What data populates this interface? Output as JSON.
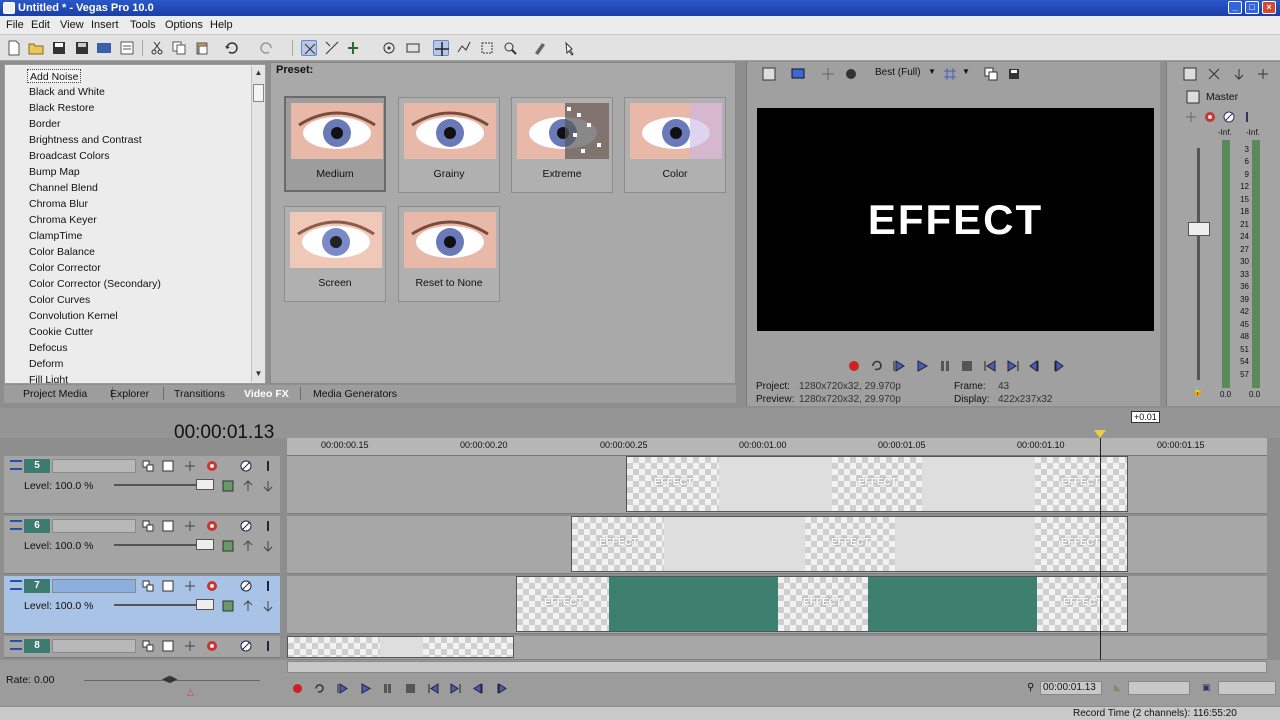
{
  "window": {
    "title": "Untitled * - Vegas Pro 10.0"
  },
  "menu": [
    "File",
    "Edit",
    "View",
    "Insert",
    "Tools",
    "Options",
    "Help"
  ],
  "fx_list": {
    "items": [
      "Add Noise",
      "Black and White",
      "Black Restore",
      "Border",
      "Brightness and Contrast",
      "Broadcast Colors",
      "Bump Map",
      "Channel Blend",
      "Chroma Blur",
      "Chroma Keyer",
      "ClampTime",
      "Color Balance",
      "Color Corrector",
      "Color Corrector (Secondary)",
      "Color Curves",
      "Convolution Kernel",
      "Cookie Cutter",
      "Defocus",
      "Deform",
      "Fill Light"
    ],
    "selected": "Add Noise"
  },
  "preset": {
    "label": "Preset:",
    "items": [
      "Medium",
      "Grainy",
      "Extreme",
      "Color",
      "Screen",
      "Reset to None"
    ],
    "selected": "Medium"
  },
  "window_tabs": [
    "Project Media",
    "Explorer",
    "Transitions",
    "Video FX",
    "Media Generators"
  ],
  "active_tab": "Video FX",
  "preview": {
    "quality": "Best (Full)",
    "screen_text": "EFFECT",
    "project_label": "Project:",
    "project_value": "1280x720x32, 29.970p",
    "preview_label": "Preview:",
    "preview_value": "1280x720x32, 29.970p",
    "frame_label": "Frame:",
    "frame_value": "43",
    "display_label": "Display:",
    "display_value": "422x237x32"
  },
  "master": {
    "label": "Master",
    "inf_left": "-Inf.",
    "inf_right": "-Inf.",
    "ticks": [
      "3",
      "6",
      "9",
      "12",
      "15",
      "18",
      "21",
      "24",
      "27",
      "30",
      "33",
      "36",
      "39",
      "42",
      "45",
      "48",
      "51",
      "54",
      "57"
    ],
    "bottom_left": "0.0",
    "bottom_right": "0.0"
  },
  "timeline": {
    "timecode": "00:00:01.13",
    "tooltip": "+0.01",
    "ruler": [
      "00:00:00.15",
      "00:00:00.20",
      "00:00:00.25",
      "00:00:01.00",
      "00:00:01.05",
      "00:00:01.10",
      "00:00:01.15"
    ],
    "clip_label": "EFFECT",
    "tracks": [
      {
        "number": "5",
        "level": "Level: 100.0 %"
      },
      {
        "number": "6",
        "level": "Level: 100.0 %"
      },
      {
        "number": "7",
        "level": "Level: 100.0 %"
      },
      {
        "number": "8"
      }
    ]
  },
  "transport": {
    "rate": "Rate: 0.00",
    "time": "00:00:01.13",
    "status": "Record Time (2 channels): 116:55:20"
  }
}
